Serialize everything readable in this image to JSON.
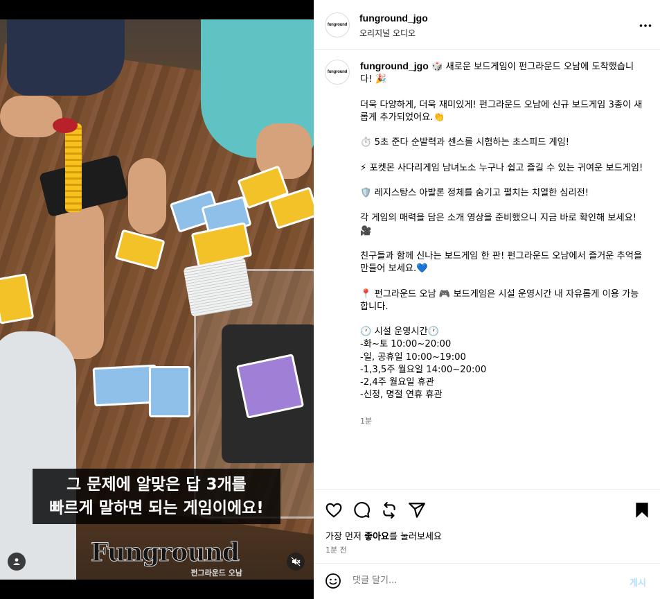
{
  "video": {
    "caption_line1": "그 문제에 알맞은 답 3개를",
    "caption_line2": "빠르게 말하면 되는 게임이에요!",
    "wordmark": "Funground",
    "wordmark_sub": "펀그라운드 오남",
    "user_icon": "person-icon",
    "mute_icon": "speaker-muted-icon"
  },
  "header": {
    "avatar_text": "funground",
    "username": "funground_jgo",
    "audio": "오리지널 오디오",
    "more_icon": "more-horizontal-icon"
  },
  "post": {
    "username": "funground_jgo",
    "caption": "🎲 새로운 보드게임이 펀그라운드 오남에 도착했습니다! 🎉\n\n더욱 다양하게, 더욱 재미있게! 펀그라운드 오남에 신규 보드게임 3종이 새롭게 추가되었어요.👏\n\n⏱️ 5초 준다 순발력과 센스를 시험하는 초스피드 게임!\n\n⚡ 포켓몬 사다리게임 남녀노소 누구나 쉽고 즐길 수 있는 귀여운 보드게임!\n\n🛡️ 레지스탕스 아발론 정체를 숨기고 펼치는 치열한 심리전!\n\n각 게임의 매력을 담은 소개 영상을 준비했으니 지금 바로 확인해 보세요! 🎥\n\n친구들과 함께 신나는 보드게임 한 판! 펀그라운드 오남에서 즐거운 추억을 만들어 보세요.💙\n\n📍 펀그라운드 오남 🎮 보드게임은 시설 운영시간 내 자유롭게 이용 가능합니다.\n\n🕐 시설 운영시간🕐\n-화~토 10:00~20:00\n-일, 공휴일 10:00~19:00\n-1,3,5주 월요일 14:00~20:00\n-2,4주 월요일 휴관\n-신정, 명절 연휴 휴관",
    "time": "1분"
  },
  "actions": {
    "like_icon": "heart-icon",
    "comment_icon": "comment-icon",
    "share_icon": "repost-icon",
    "send_icon": "send-icon",
    "save_icon": "bookmark-icon",
    "likes_prefix": "가장 먼저 ",
    "likes_bold": "좋아요",
    "likes_suffix": "를 눌러보세요",
    "ago": "1분 전"
  },
  "comment": {
    "emoji_icon": "smiley-icon",
    "placeholder": "댓글 달기...",
    "post_label": "게시"
  }
}
